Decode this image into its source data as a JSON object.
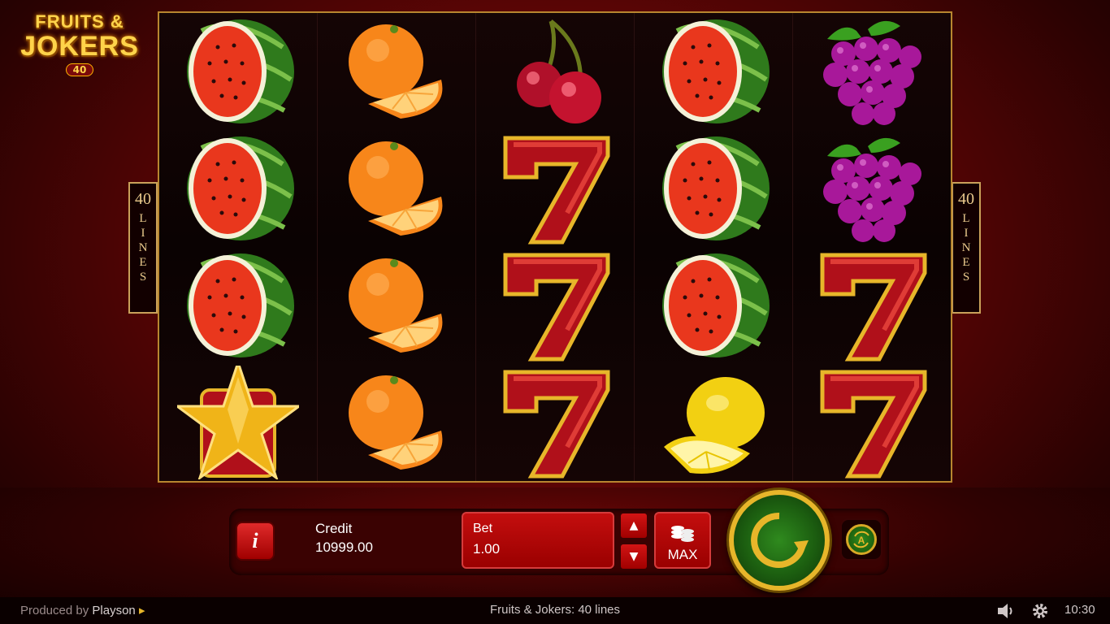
{
  "game": {
    "logo_line1": "FRUITS &",
    "logo_line2": "JOKERS",
    "logo_badge": "40",
    "lines_number": "40",
    "lines_word": "LINES"
  },
  "reels": [
    [
      "watermelon",
      "watermelon",
      "watermelon",
      "star"
    ],
    [
      "orange",
      "orange",
      "orange",
      "orange"
    ],
    [
      "cherry",
      "seven",
      "seven",
      "seven"
    ],
    [
      "watermelon",
      "watermelon",
      "watermelon",
      "lemon"
    ],
    [
      "grapes",
      "grapes",
      "seven",
      "seven"
    ]
  ],
  "controls": {
    "info_label": "i",
    "credit_label": "Credit",
    "credit_value": "10999.00",
    "bet_label": "Bet",
    "bet_value": "1.00",
    "bet_up_icon": "triangle-up-icon",
    "bet_down_icon": "triangle-down-icon",
    "max_label": "MAX",
    "spin_icon": "spin-arrow-icon",
    "autoplay_icon": "autoplay-icon"
  },
  "footer": {
    "produced_by": "Produced by",
    "provider": "Playson",
    "title": "Fruits & Jokers: 40 lines",
    "time": "10:30"
  },
  "colors": {
    "accent_gold": "#e7b62a",
    "spin_green": "#2f8a1e",
    "button_red": "#c40e0e"
  }
}
